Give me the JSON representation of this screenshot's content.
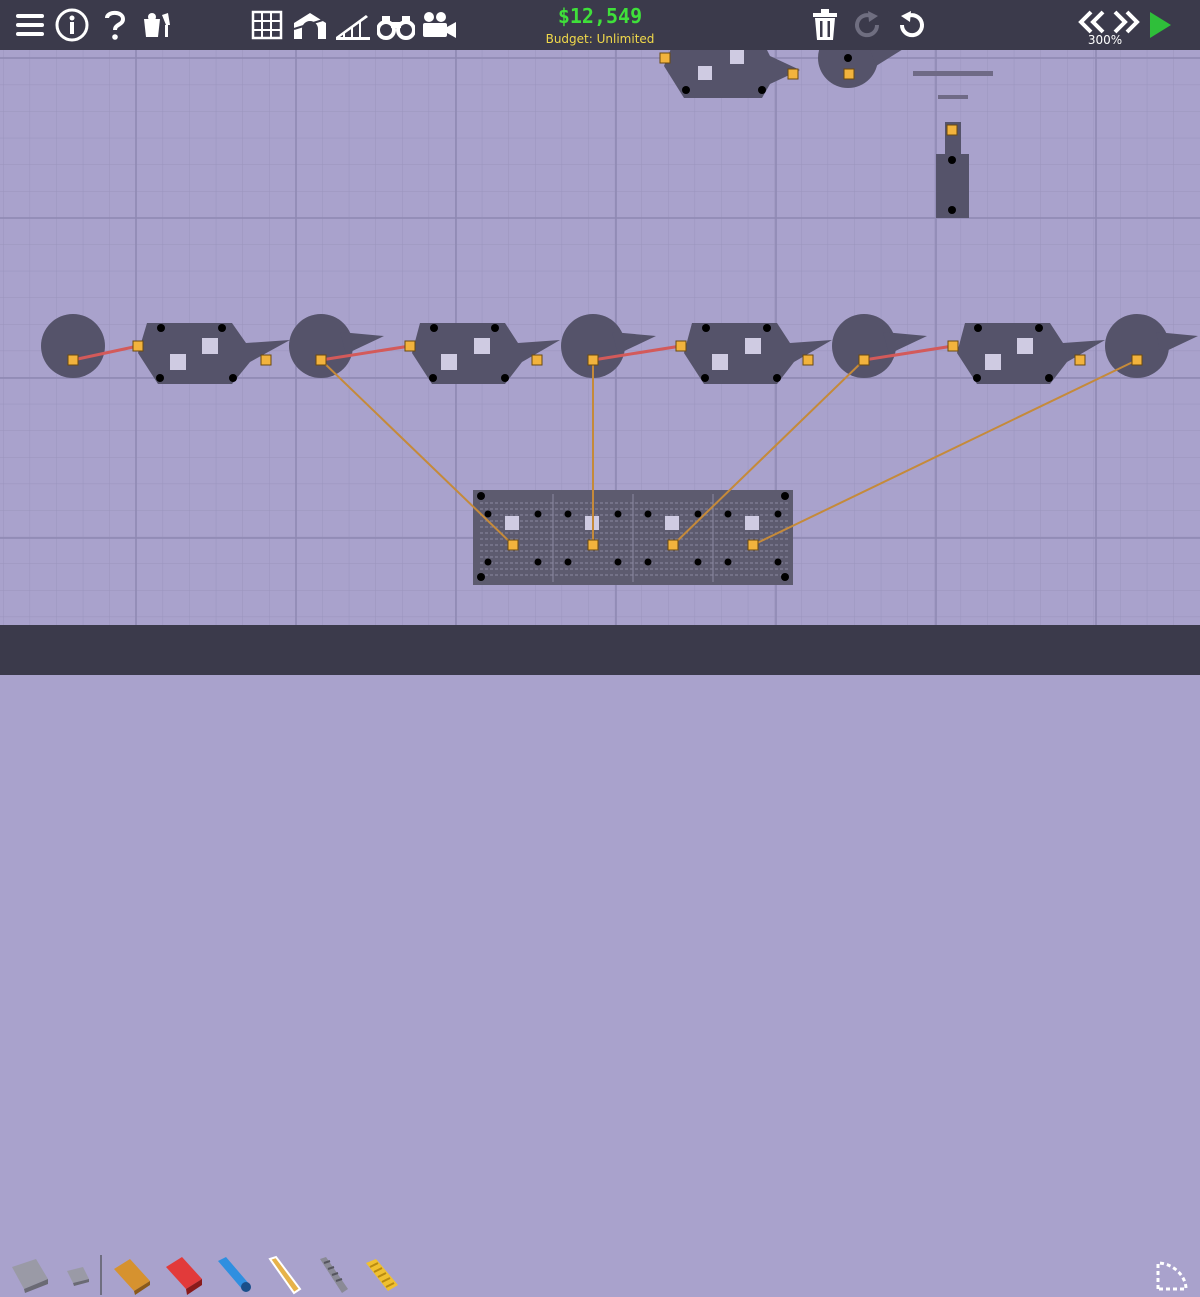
{
  "toolbar": {
    "left_icons": [
      "menu-icon",
      "info-icon",
      "help-icon",
      "theme-icon"
    ],
    "center_icons": [
      "grid-icon",
      "arch-icon",
      "ramp-icon",
      "binoculars-icon",
      "camera-icon"
    ],
    "right_icons": [
      "trash-icon",
      "redo-icon",
      "undo-icon"
    ],
    "speed_icons": [
      "rewind-icon",
      "fast-forward-icon",
      "play-icon"
    ]
  },
  "budget": {
    "amount": "$12,549",
    "label": "Budget: Unlimited"
  },
  "simulation": {
    "speed": "300%"
  },
  "materials": {
    "items": [
      "road-eraser-tool",
      "small-eraser-tool",
      "wood-material",
      "reinforced-road-material",
      "hydraulic-material",
      "rope-material",
      "steel-cable-material",
      "spring-material"
    ]
  },
  "colors": {
    "toolbar_bg": "#3b3a4b",
    "canvas_bg": "#a9a2cc",
    "part_fill": "#55536a",
    "joint_anchor": "#f2b33d",
    "wood": "#c58a3a",
    "road": "#d35a5a",
    "budget_green": "#3fe03a",
    "budget_label": "#f1d94a",
    "play_green": "#2fbf3a"
  }
}
